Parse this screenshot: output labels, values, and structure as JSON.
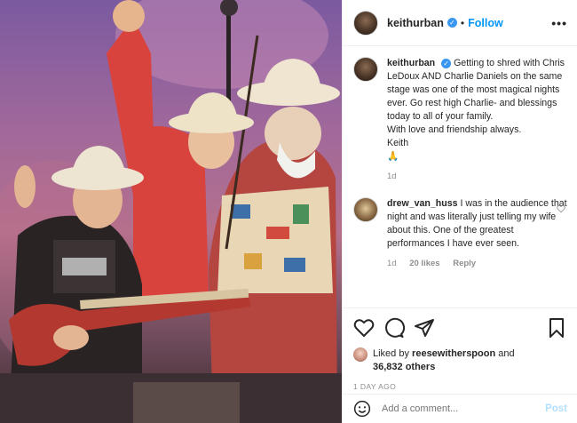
{
  "post": {
    "username": "keithurban",
    "follow_label": "Follow",
    "dot": "•",
    "more": "•••",
    "caption": {
      "username": "keithurban",
      "text": "Getting to shred with Chris LeDoux AND Charlie Daniels on the same stage was one of the most magical nights ever. Go rest high Charlie- and blessings today to all of your family.",
      "line2": "With love and friendship always.",
      "line3": "Keith",
      "emoji": "🙏",
      "age": "1d"
    },
    "comments": [
      {
        "username": "drew_van_huss",
        "text": "I was in the audience that night and was literally just telling my wife about this. One of the greatest performances I have ever seen.",
        "age": "1d",
        "likes": "20 likes",
        "reply": "Reply"
      }
    ],
    "likes": {
      "prefix": "Liked by",
      "first_user": "reesewitherspoon",
      "and": "and",
      "others": "36,832 others"
    },
    "timestamp": "1 DAY AGO",
    "add_comment": {
      "placeholder": "Add a comment...",
      "post_label": "Post"
    }
  },
  "colors": {
    "link_blue": "#0095f6",
    "verified_blue": "#3897f0",
    "muted": "#8e8e8e",
    "post_disabled": "#b2dffc"
  },
  "icons": [
    "verified-badge",
    "heart-icon",
    "comment-icon",
    "share-icon",
    "bookmark-icon",
    "emoji-icon",
    "more-icon"
  ]
}
